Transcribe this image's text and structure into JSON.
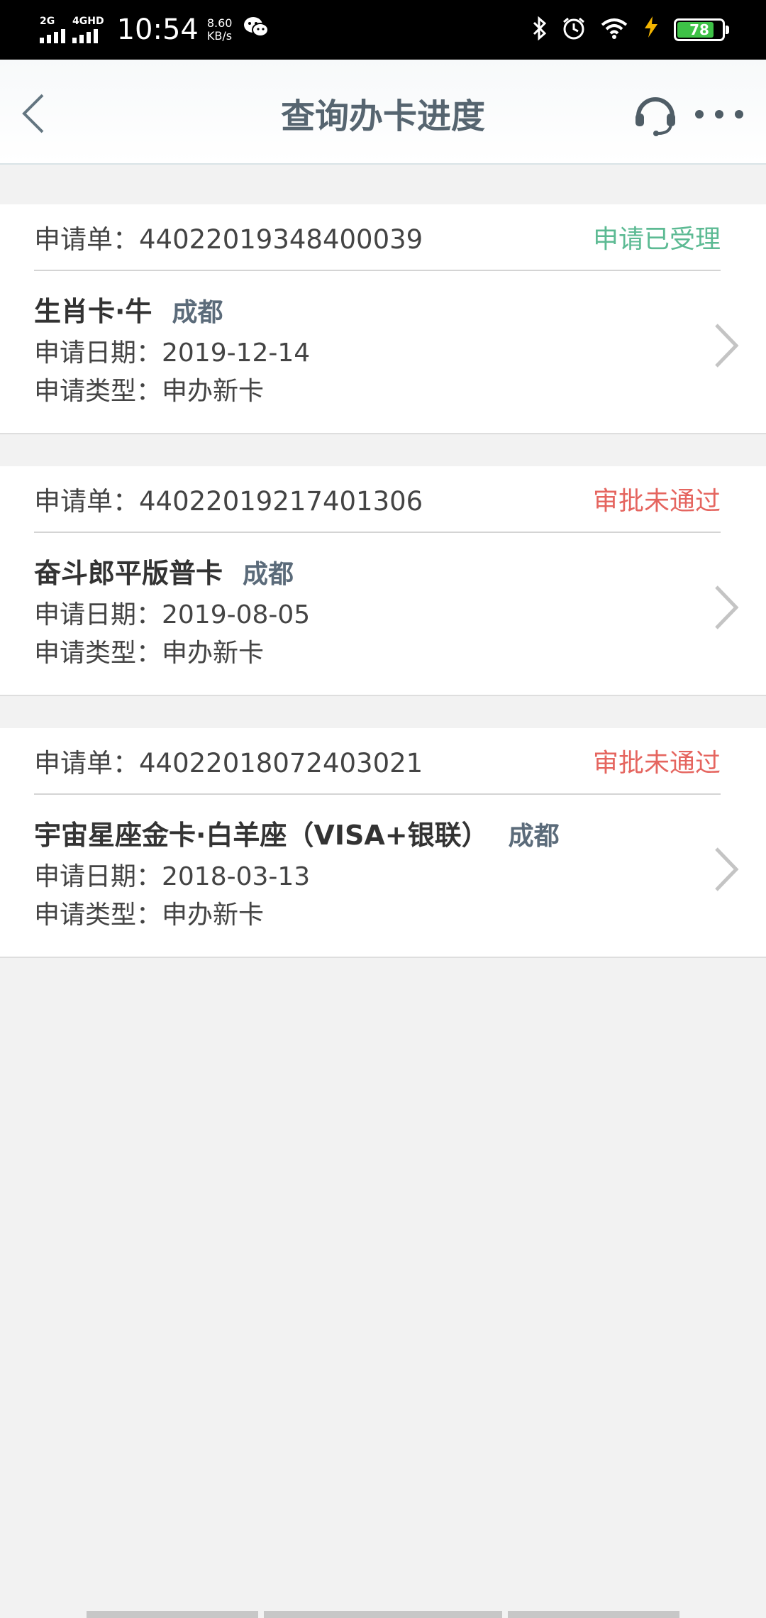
{
  "status_bar": {
    "sim1": "2G",
    "sim2": "4GHD",
    "time": "10:54",
    "speed_value": "8.60",
    "speed_unit": "KB/s",
    "battery": "78",
    "icons": [
      "wechat-icon",
      "bluetooth-icon",
      "alarm-icon",
      "wifi-icon",
      "charging-icon",
      "battery-icon"
    ]
  },
  "header": {
    "title": "查询办卡进度"
  },
  "applications": [
    {
      "order_label": "申请单：44022019348400039",
      "status": "申请已受理",
      "status_color": "#5cba93",
      "card_name": "生肖卡·牛",
      "city": "成都",
      "date_line": "申请日期：2019-12-14",
      "type_line": "申请类型：申办新卡"
    },
    {
      "order_label": "申请单：44022019217401306",
      "status": "审批未通过",
      "status_color": "#e5655f",
      "card_name": "奋斗郎平版普卡",
      "city": "成都",
      "date_line": "申请日期：2019-08-05",
      "type_line": "申请类型：申办新卡"
    },
    {
      "order_label": "申请单：44022018072403021",
      "status": "审批未通过",
      "status_color": "#e5655f",
      "card_name": "宇宙星座金卡·白羊座（VISA+银联）",
      "city": "成都",
      "date_line": "申请日期：2018-03-13",
      "type_line": "申请类型：申办新卡"
    }
  ]
}
